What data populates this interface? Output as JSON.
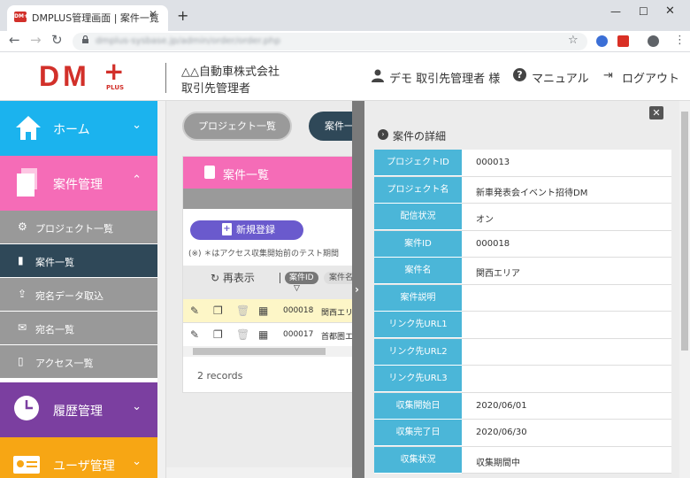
{
  "browser": {
    "tab_title": "DMPLUS管理画面 | 案件一覧",
    "favicon_text": "DM+",
    "url": "dmplus-sysbase.jp/admin/order/order.php",
    "new_tab": "+",
    "close": "✕"
  },
  "header": {
    "logo": "DM",
    "logo_plus": "+",
    "logo_sub": "PLUS",
    "company": "△△自動車株式会社",
    "role": "取引先管理者",
    "user": "デモ 取引先管理者 様",
    "manual": "マニュアル",
    "logout": "ログアウト"
  },
  "sidebar": {
    "home": "ホーム",
    "case_mgmt": "案件管理",
    "sub": [
      {
        "label": "プロジェクト一覧",
        "icon": "gear-icon"
      },
      {
        "label": "案件一覧",
        "icon": "clipboard-icon"
      },
      {
        "label": "宛名データ取込",
        "icon": "upload-icon"
      },
      {
        "label": "宛名一覧",
        "icon": "envelope-icon"
      },
      {
        "label": "アクセス一覧",
        "icon": "mobile-icon"
      }
    ],
    "history": "履歴管理",
    "users": "ユーザ管理",
    "colors": {
      "home": "#1bb3ee",
      "case": "#f56cb7",
      "history": "#7b3fa0",
      "users": "#f7a614",
      "active": "#2f4858"
    }
  },
  "main": {
    "btn_projects": "プロジェクト一覧",
    "btn_cases": "案件一",
    "card_title": "案件一覧",
    "btn_new": "新規登録",
    "note": "(※) ＊はアクセス収集開始前のテスト期間",
    "refresh": "再表示",
    "col_caseid": "案件ID",
    "col_casename": "案件名",
    "rows": [
      {
        "id": "000018",
        "name": "関西エリ"
      },
      {
        "id": "000017",
        "name": "首都圏エ"
      }
    ],
    "records": "2 records"
  },
  "detail": {
    "title": "案件の詳細",
    "rows": [
      {
        "label": "プロジェクトID",
        "value": "000013"
      },
      {
        "label": "プロジェクト名",
        "value": "新車発表会イベント招待DM"
      },
      {
        "label": "配信状況",
        "value": "オン"
      },
      {
        "label": "案件ID",
        "value": "000018"
      },
      {
        "label": "案件名",
        "value": "関西エリア"
      },
      {
        "label": "案件説明",
        "value": ""
      },
      {
        "label": "リンク先URL1",
        "value": ""
      },
      {
        "label": "リンク先URL2",
        "value": ""
      },
      {
        "label": "リンク先URL3",
        "value": ""
      },
      {
        "label": "収集開始日",
        "value": "2020/06/01"
      },
      {
        "label": "収集完了日",
        "value": "2020/06/30"
      },
      {
        "label": "収集状況",
        "value": "収集期間中"
      }
    ]
  }
}
